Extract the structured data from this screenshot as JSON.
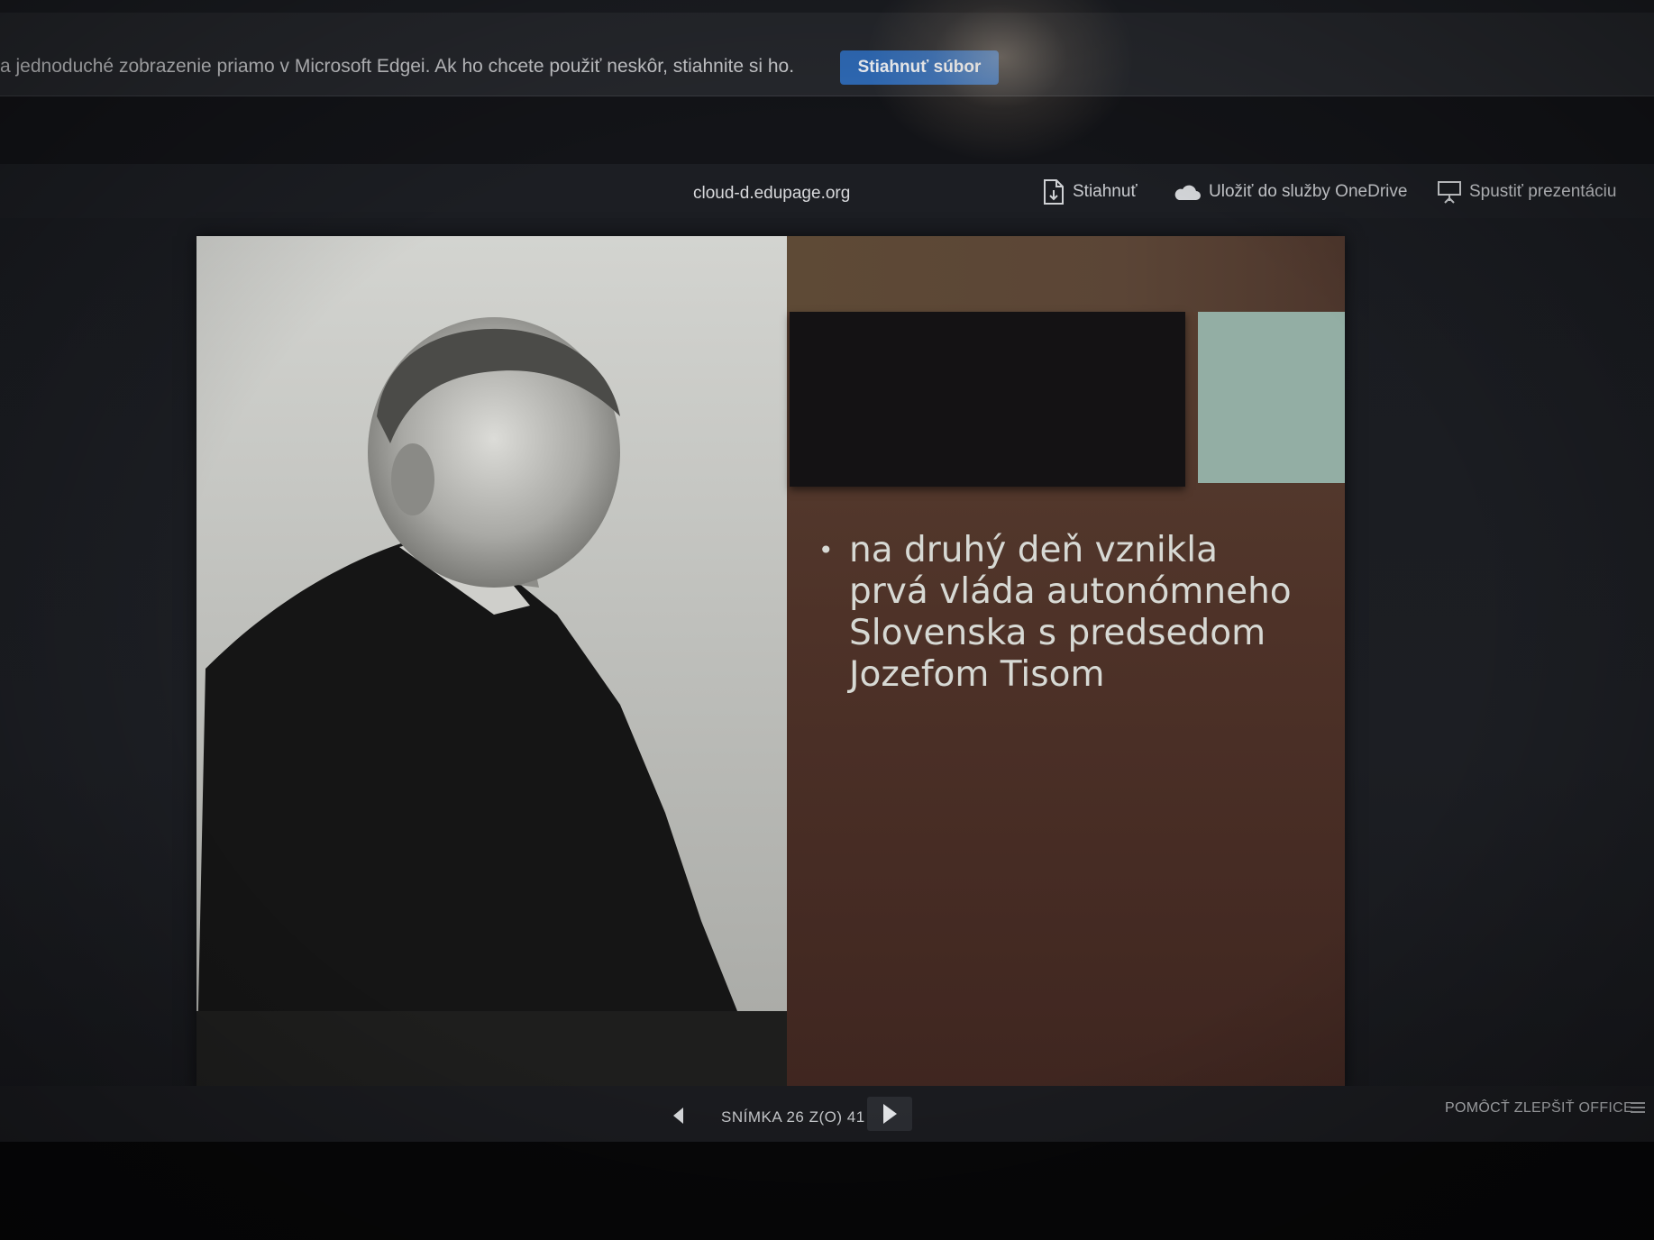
{
  "infobar": {
    "message": "a jednoduché zobrazenie priamo v Microsoft Edgei. Ak ho chcete použiť neskôr, stiahnite si ho.",
    "download_file_label": "Stiahnuť súbor"
  },
  "viewer": {
    "title": "cloud-d.edupage.org",
    "actions": {
      "download": {
        "label": "Stiahnuť",
        "icon": "document-download-icon"
      },
      "onedrive": {
        "label": "Uložiť do služby OneDrive",
        "icon": "cloud-icon"
      },
      "present": {
        "label": "Spustiť prezentáciu",
        "icon": "projector-icon"
      }
    }
  },
  "slide": {
    "bullet_text": "na druhý deň vznikla prvá vláda autonómneho Slovenska s predsedom Jozefom Tisom",
    "colors": {
      "right_panel": "#4e3228",
      "dark_block": "#141214",
      "teal_block": "#93aea4",
      "text": "#d7d9d4"
    }
  },
  "status": {
    "slide_counter": "SNÍMKA 26 Z(O) 41",
    "help_improve": "POMÔCŤ ZLEPŠIŤ OFFICE"
  },
  "colors": {
    "accent_button": "#2f6bb8",
    "viewer_bg": "#1c1e23"
  }
}
